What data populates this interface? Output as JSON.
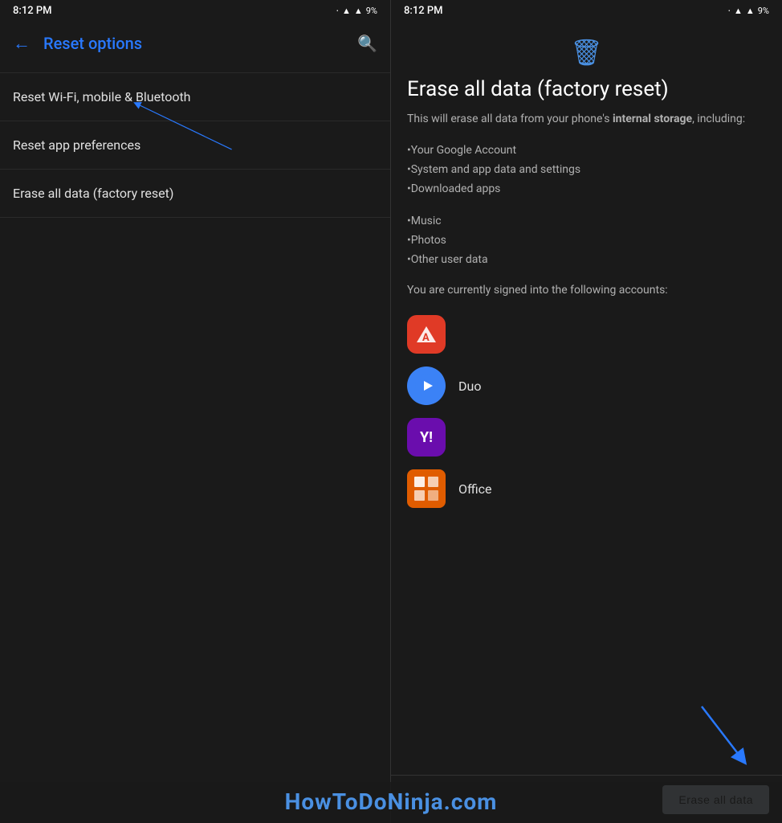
{
  "left_panel": {
    "status": {
      "time": "8:12 PM",
      "battery": "9%"
    },
    "header": {
      "back_label": "←",
      "title": "Reset options",
      "search_label": "🔍"
    },
    "menu_items": [
      {
        "id": "reset-wifi",
        "label": "Reset Wi-Fi, mobile & Bluetooth"
      },
      {
        "id": "reset-apps",
        "label": "Reset app preferences"
      },
      {
        "id": "factory-reset",
        "label": "Erase all data (factory reset)"
      }
    ]
  },
  "right_panel": {
    "status": {
      "time": "8:12 PM",
      "battery": "9%"
    },
    "content": {
      "title": "Erase all data (factory reset)",
      "description_prefix": "This will erase all data from your phone's ",
      "description_bold": "internal storage",
      "description_suffix": ", including:",
      "items": [
        "•Your Google Account",
        "•System and app data and settings",
        "•Downloaded apps",
        "•Music",
        "•Photos",
        "•Other user data"
      ],
      "accounts_label": "You are currently signed into the following accounts:",
      "accounts": [
        {
          "id": "adobe",
          "label": "",
          "icon_type": "adobe",
          "color": "#e03a26",
          "symbol": "A"
        },
        {
          "id": "duo",
          "label": "Duo",
          "icon_type": "duo",
          "color": "#3b82f6",
          "symbol": "▶"
        },
        {
          "id": "yahoo",
          "label": "",
          "icon_type": "yahoo",
          "color": "#6a0dad",
          "symbol": "Y!"
        },
        {
          "id": "office",
          "label": "Office",
          "icon_type": "office",
          "color": "#e05c00",
          "symbol": "⊞"
        }
      ]
    },
    "erase_button_label": "Erase all data"
  },
  "watermark": {
    "text": "HowToDoNinja.com"
  },
  "icons": {
    "bluetooth": "⊕",
    "wifi": "▲",
    "battery": "▓",
    "trash": "🗑"
  }
}
